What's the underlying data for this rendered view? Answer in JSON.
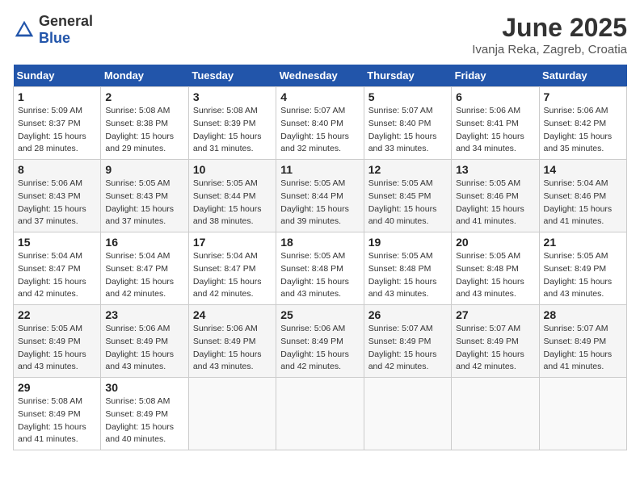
{
  "header": {
    "logo_general": "General",
    "logo_blue": "Blue",
    "month": "June 2025",
    "location": "Ivanja Reka, Zagreb, Croatia"
  },
  "weekdays": [
    "Sunday",
    "Monday",
    "Tuesday",
    "Wednesday",
    "Thursday",
    "Friday",
    "Saturday"
  ],
  "weeks": [
    [
      {
        "day": "1",
        "sunrise": "5:09 AM",
        "sunset": "8:37 PM",
        "daylight": "15 hours and 28 minutes."
      },
      {
        "day": "2",
        "sunrise": "5:08 AM",
        "sunset": "8:38 PM",
        "daylight": "15 hours and 29 minutes."
      },
      {
        "day": "3",
        "sunrise": "5:08 AM",
        "sunset": "8:39 PM",
        "daylight": "15 hours and 31 minutes."
      },
      {
        "day": "4",
        "sunrise": "5:07 AM",
        "sunset": "8:40 PM",
        "daylight": "15 hours and 32 minutes."
      },
      {
        "day": "5",
        "sunrise": "5:07 AM",
        "sunset": "8:40 PM",
        "daylight": "15 hours and 33 minutes."
      },
      {
        "day": "6",
        "sunrise": "5:06 AM",
        "sunset": "8:41 PM",
        "daylight": "15 hours and 34 minutes."
      },
      {
        "day": "7",
        "sunrise": "5:06 AM",
        "sunset": "8:42 PM",
        "daylight": "15 hours and 35 minutes."
      }
    ],
    [
      {
        "day": "8",
        "sunrise": "5:06 AM",
        "sunset": "8:43 PM",
        "daylight": "15 hours and 37 minutes."
      },
      {
        "day": "9",
        "sunrise": "5:05 AM",
        "sunset": "8:43 PM",
        "daylight": "15 hours and 37 minutes."
      },
      {
        "day": "10",
        "sunrise": "5:05 AM",
        "sunset": "8:44 PM",
        "daylight": "15 hours and 38 minutes."
      },
      {
        "day": "11",
        "sunrise": "5:05 AM",
        "sunset": "8:44 PM",
        "daylight": "15 hours and 39 minutes."
      },
      {
        "day": "12",
        "sunrise": "5:05 AM",
        "sunset": "8:45 PM",
        "daylight": "15 hours and 40 minutes."
      },
      {
        "day": "13",
        "sunrise": "5:05 AM",
        "sunset": "8:46 PM",
        "daylight": "15 hours and 41 minutes."
      },
      {
        "day": "14",
        "sunrise": "5:04 AM",
        "sunset": "8:46 PM",
        "daylight": "15 hours and 41 minutes."
      }
    ],
    [
      {
        "day": "15",
        "sunrise": "5:04 AM",
        "sunset": "8:47 PM",
        "daylight": "15 hours and 42 minutes."
      },
      {
        "day": "16",
        "sunrise": "5:04 AM",
        "sunset": "8:47 PM",
        "daylight": "15 hours and 42 minutes."
      },
      {
        "day": "17",
        "sunrise": "5:04 AM",
        "sunset": "8:47 PM",
        "daylight": "15 hours and 42 minutes."
      },
      {
        "day": "18",
        "sunrise": "5:05 AM",
        "sunset": "8:48 PM",
        "daylight": "15 hours and 43 minutes."
      },
      {
        "day": "19",
        "sunrise": "5:05 AM",
        "sunset": "8:48 PM",
        "daylight": "15 hours and 43 minutes."
      },
      {
        "day": "20",
        "sunrise": "5:05 AM",
        "sunset": "8:48 PM",
        "daylight": "15 hours and 43 minutes."
      },
      {
        "day": "21",
        "sunrise": "5:05 AM",
        "sunset": "8:49 PM",
        "daylight": "15 hours and 43 minutes."
      }
    ],
    [
      {
        "day": "22",
        "sunrise": "5:05 AM",
        "sunset": "8:49 PM",
        "daylight": "15 hours and 43 minutes."
      },
      {
        "day": "23",
        "sunrise": "5:06 AM",
        "sunset": "8:49 PM",
        "daylight": "15 hours and 43 minutes."
      },
      {
        "day": "24",
        "sunrise": "5:06 AM",
        "sunset": "8:49 PM",
        "daylight": "15 hours and 43 minutes."
      },
      {
        "day": "25",
        "sunrise": "5:06 AM",
        "sunset": "8:49 PM",
        "daylight": "15 hours and 42 minutes."
      },
      {
        "day": "26",
        "sunrise": "5:07 AM",
        "sunset": "8:49 PM",
        "daylight": "15 hours and 42 minutes."
      },
      {
        "day": "27",
        "sunrise": "5:07 AM",
        "sunset": "8:49 PM",
        "daylight": "15 hours and 42 minutes."
      },
      {
        "day": "28",
        "sunrise": "5:07 AM",
        "sunset": "8:49 PM",
        "daylight": "15 hours and 41 minutes."
      }
    ],
    [
      {
        "day": "29",
        "sunrise": "5:08 AM",
        "sunset": "8:49 PM",
        "daylight": "15 hours and 41 minutes."
      },
      {
        "day": "30",
        "sunrise": "5:08 AM",
        "sunset": "8:49 PM",
        "daylight": "15 hours and 40 minutes."
      },
      null,
      null,
      null,
      null,
      null
    ]
  ]
}
